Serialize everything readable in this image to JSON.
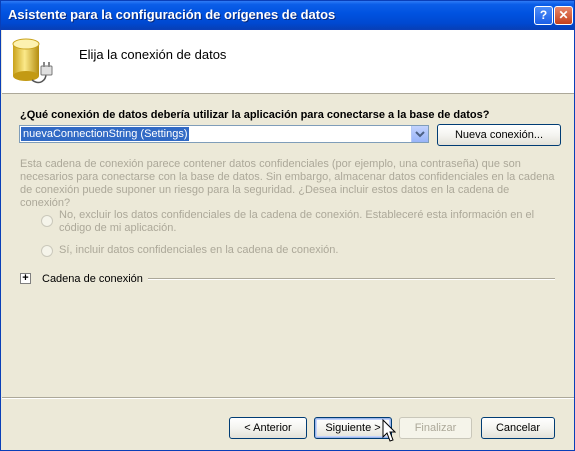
{
  "window": {
    "title": "Asistente para la configuración de orígenes de datos",
    "help_button": "?",
    "close_button": "✕"
  },
  "header": {
    "title": "Elija la conexión de datos",
    "icon": "database-plug-icon"
  },
  "question": "¿Qué conexión de datos debería utilizar la aplicación para conectarse a la base de datos?",
  "connection_select": {
    "selected": "nuevaConnectionString (Settings)"
  },
  "new_connection_button": "Nueva conexión...",
  "sensitive_info": "Esta cadena de conexión parece contener datos confidenciales (por ejemplo, una contraseña) que son necesarios para conectarse con la base de datos. Sin embargo, almacenar datos confidenciales en la cadena de conexión puede suponer un riesgo para la seguridad. ¿Desea incluir estos datos en la cadena de conexión?",
  "options": {
    "exclude": "No, excluir los datos confidenciales de la cadena de conexión. Estableceré esta información en el código de mi aplicación.",
    "include": "Sí, incluir datos confidenciales en la cadena de conexión."
  },
  "connection_string_expander": {
    "toggle": "+",
    "label": "Cadena de conexión"
  },
  "footer": {
    "previous": "< Anterior",
    "next": "Siguiente >",
    "finish": "Finalizar",
    "cancel": "Cancelar"
  },
  "colors": {
    "titlebar": "#0052e0",
    "selection": "#316ac5",
    "dialog_bg": "#ece9d8",
    "disabled_text": "#aca899"
  }
}
